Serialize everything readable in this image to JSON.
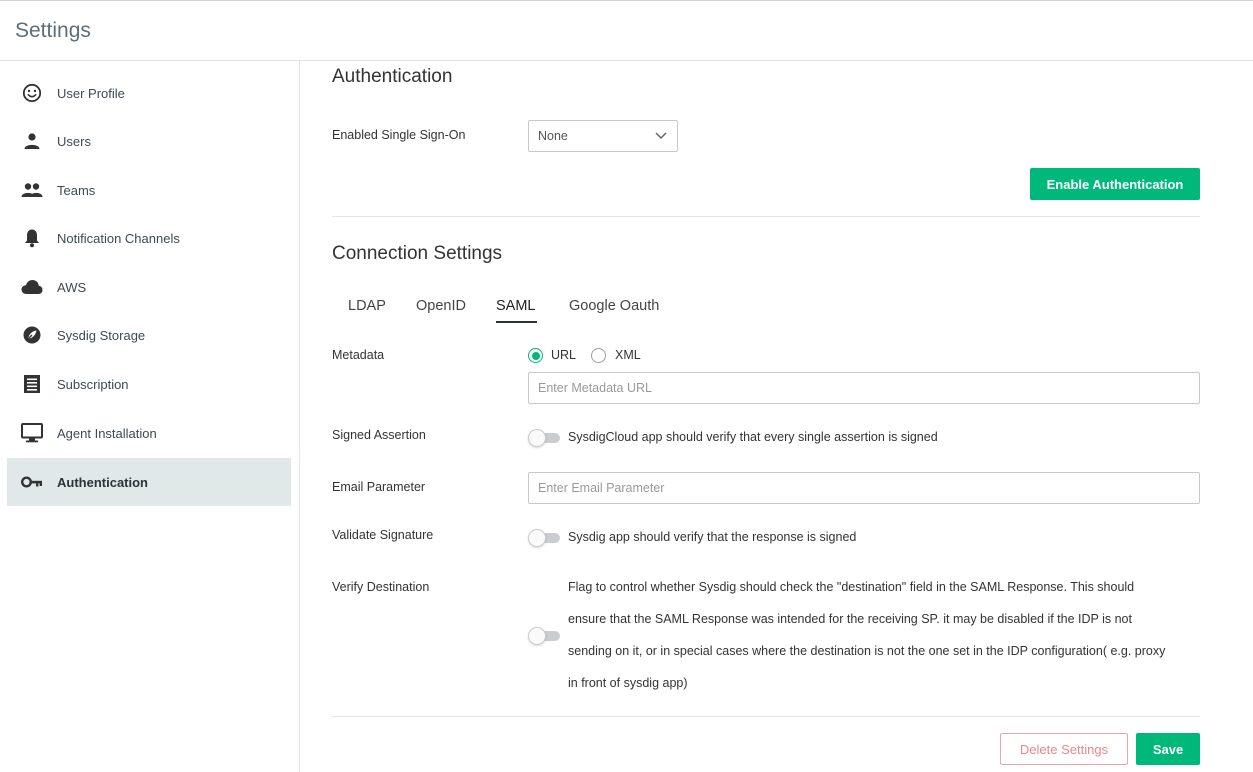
{
  "app": {
    "title": "Settings"
  },
  "sidebar": {
    "items": [
      {
        "label": "User Profile",
        "icon": "smiley-icon"
      },
      {
        "label": "Users",
        "icon": "person-icon"
      },
      {
        "label": "Teams",
        "icon": "group-icon"
      },
      {
        "label": "Notification Channels",
        "icon": "bell-icon"
      },
      {
        "label": "AWS",
        "icon": "cloud-icon"
      },
      {
        "label": "Sysdig Storage",
        "icon": "storage-icon"
      },
      {
        "label": "Subscription",
        "icon": "receipt-icon"
      },
      {
        "label": "Agent Installation",
        "icon": "monitor-icon"
      },
      {
        "label": "Authentication",
        "icon": "key-icon",
        "active": true
      }
    ]
  },
  "auth": {
    "title": "Authentication",
    "sso_label": "Enabled Single Sign-On",
    "sso_value": "None",
    "enable_button": "Enable Authentication"
  },
  "connection": {
    "title": "Connection Settings",
    "tabs": [
      {
        "label": "LDAP"
      },
      {
        "label": "OpenID"
      },
      {
        "label": "SAML",
        "active": true
      },
      {
        "label": "Google Oauth"
      }
    ],
    "metadata_label": "Metadata",
    "metadata_options": [
      "URL",
      "XML"
    ],
    "metadata_selected": "URL",
    "metadata_placeholder": "Enter Metadata URL",
    "signed_assertion_label": "Signed Assertion",
    "signed_assertion_desc": "SysdigCloud app should verify that every single assertion is signed",
    "email_label": "Email Parameter",
    "email_placeholder": "Enter Email Parameter",
    "validate_label": "Validate Signature",
    "validate_desc": "Sysdig app should verify that the response is signed",
    "verify_label": "Verify Destination",
    "verify_desc": "Flag to control whether Sysdig should check the \"destination\" field in the SAML Response. This should ensure that the SAML Response was intended for the receiving SP. it may be disabled if the IDP is not sending on it, or in special cases where the destination is not the one set in the IDP configuration( e.g. proxy in front of sysdig app)"
  },
  "footer": {
    "delete_label": "Delete Settings",
    "save_label": "Save"
  },
  "colors": {
    "accent": "#00b87a",
    "active_nav_bg": "#e1e8e8",
    "danger_outline": "#e8a7aa"
  }
}
